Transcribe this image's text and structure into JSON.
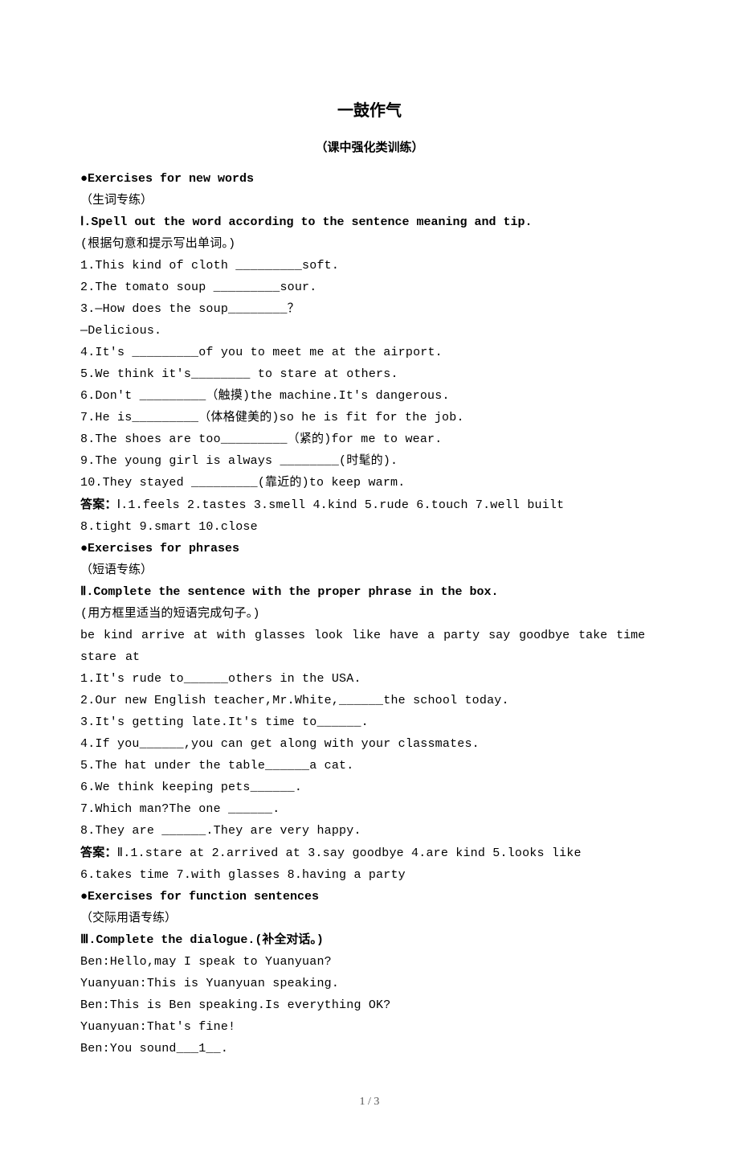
{
  "title": "一鼓作气",
  "subtitle": "（课中强化类训练）",
  "s1": {
    "head": "●Exercises for new words",
    "note": "（生词专练）",
    "instr_label": "Ⅰ.Spell out the word according to the sentence meaning and tip.",
    "instr_cn": "(根据句意和提示写出单词。)",
    "q1": "1.This kind of cloth _________soft.",
    "q2": "2.The tomato soup  _________sour.",
    "q3a": "3.—How does the soup________？",
    "q3b": "—Delicious.",
    "q4": "4.It's _________of you to meet me at the airport.",
    "q5": "5.We think it's________ to stare at others.",
    "q6": "6.Don't _________（触摸)the machine.It's dangerous.",
    "q7": "7.He is_________（体格健美的)so he is fit for the job.",
    "q8": "8.The shoes are too_________（紧的)for me to wear.",
    "q9": "9.The young girl is always ________(时髦的).",
    "q10": "10.They stayed _________(靠近的)to keep warm.",
    "ans_label": "答案：",
    "ans_line1": "Ⅰ.1.feels  2.tastes  3.smell  4.kind  5.rude  6.touch   7.well  built",
    "ans_line2": "8.tight  9.smart  10.close"
  },
  "s2": {
    "head": "●Exercises for phrases",
    "note": "（短语专练）",
    "instr_label": "Ⅱ.Complete the sentence with the proper phrase in the box.",
    "instr_cn": "(用方框里适当的短语完成句子。)",
    "box_l1": "be kind  arrive at  with glasses  look like  have a party  say goodbye  take  time",
    "box_l2": "stare at",
    "q1": "1.It's rude to______others in the USA.",
    "q2": "2.Our new English teacher,Mr.White,______the school today.",
    "q3": "3.It's getting late.It's time to______.",
    "q4": "4.If you______,you can get along with your classmates.",
    "q5": "5.The hat under the table______a cat.",
    "q6": "6.We think keeping pets______.",
    "q7": "7.Which man?The one ______.",
    "q8": "8.They are ______.They are very happy.",
    "ans_label": "答案：",
    "ans_line1": "Ⅱ.1.stare at  2.arrived at  3.say goodbye   4.are   kind  5.looks like",
    "ans_line2": "6.takes time  7.with glasses   8.having a party"
  },
  "s3": {
    "head": "●Exercises for function sentences",
    "note": "（交际用语专练）",
    "instr_label": "Ⅲ.Complete the dialogue.(补全对话。)",
    "d1": "Ben:Hello,may I speak to Yuanyuan?",
    "d2": "Yuanyuan:This is Yuanyuan speaking.",
    "d3": "Ben:This is Ben speaking.Is everything OK?",
    "d4": "Yuanyuan:That's fine!",
    "d5": "Ben:You sound___1__."
  },
  "pagenum": "1 / 3"
}
